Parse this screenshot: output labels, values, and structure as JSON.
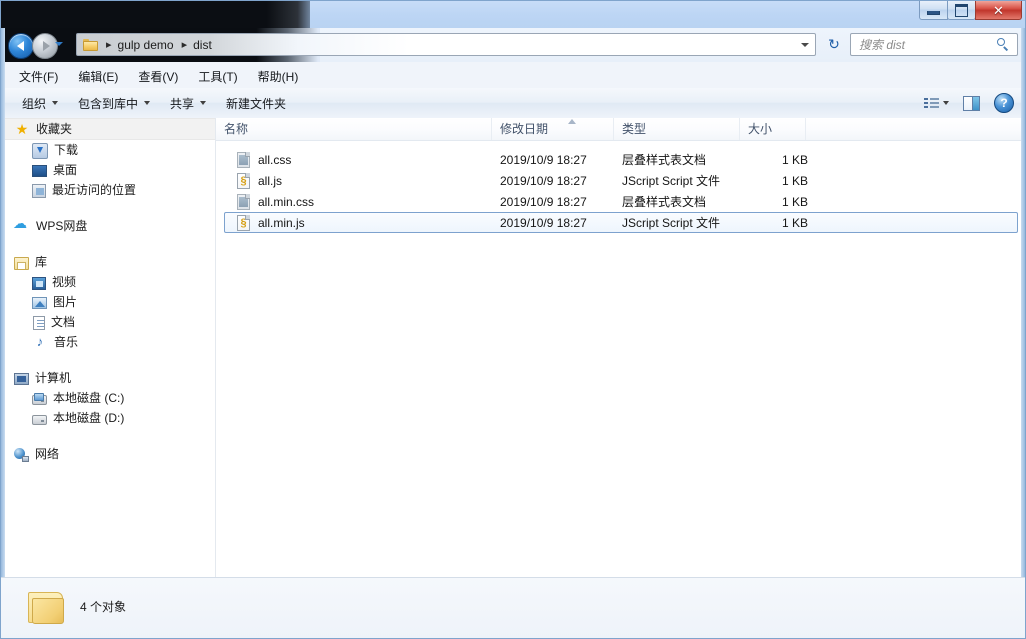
{
  "window": {
    "controls": {
      "minimize": "minimize",
      "maximize": "maximize",
      "close": "✕"
    }
  },
  "address": {
    "breadcrumb": [
      {
        "label": "gulp demo"
      },
      {
        "label": "dist"
      }
    ],
    "separator": "▸",
    "dropdown": "▾",
    "refresh_icon": "↻"
  },
  "search": {
    "placeholder": "搜索 dist",
    "value": ""
  },
  "menubar": {
    "items": [
      {
        "label": "文件(F)"
      },
      {
        "label": "编辑(E)"
      },
      {
        "label": "查看(V)"
      },
      {
        "label": "工具(T)"
      },
      {
        "label": "帮助(H)"
      }
    ]
  },
  "toolbar": {
    "items": [
      {
        "label": "组织",
        "has_caret": true
      },
      {
        "label": "包含到库中",
        "has_caret": true
      },
      {
        "label": "共享",
        "has_caret": true
      },
      {
        "label": "新建文件夹",
        "has_caret": false
      }
    ],
    "help_label": "?"
  },
  "sidebar": {
    "groups": [
      {
        "header": {
          "label": "收藏夹",
          "icon": "star-icon"
        },
        "items": [
          {
            "label": "下载",
            "icon": "download-icon"
          },
          {
            "label": "桌面",
            "icon": "desktop-icon"
          },
          {
            "label": "最近访问的位置",
            "icon": "recent-places-icon"
          }
        ]
      },
      {
        "header": {
          "label": "WPS网盘",
          "icon": "cloud-icon"
        },
        "items": []
      },
      {
        "header": {
          "label": "库",
          "icon": "library-icon"
        },
        "items": [
          {
            "label": "视频",
            "icon": "video-icon"
          },
          {
            "label": "图片",
            "icon": "picture-icon"
          },
          {
            "label": "文档",
            "icon": "document-icon"
          },
          {
            "label": "音乐",
            "icon": "music-icon"
          }
        ]
      },
      {
        "header": {
          "label": "计算机",
          "icon": "computer-icon"
        },
        "items": [
          {
            "label": "本地磁盘 (C:)",
            "icon": "system-drive-icon"
          },
          {
            "label": "本地磁盘 (D:)",
            "icon": "drive-icon"
          }
        ]
      },
      {
        "header": {
          "label": "网络",
          "icon": "network-icon"
        },
        "items": []
      }
    ]
  },
  "filelist": {
    "columns": [
      {
        "label": "名称"
      },
      {
        "label": "修改日期"
      },
      {
        "label": "类型"
      },
      {
        "label": "大小"
      }
    ],
    "sort_column": "名称",
    "rows": [
      {
        "name": "all.css",
        "date": "2019/10/9 18:27",
        "type": "层叠样式表文档",
        "size": "1 KB",
        "icon": "css-file-icon",
        "selected": false,
        "glyph": ""
      },
      {
        "name": "all.js",
        "date": "2019/10/9 18:27",
        "type": "JScript Script 文件",
        "size": "1 KB",
        "icon": "js-file-icon",
        "selected": false,
        "glyph": "§"
      },
      {
        "name": "all.min.css",
        "date": "2019/10/9 18:27",
        "type": "层叠样式表文档",
        "size": "1 KB",
        "icon": "css-file-icon",
        "selected": false,
        "glyph": ""
      },
      {
        "name": "all.min.js",
        "date": "2019/10/9 18:27",
        "type": "JScript Script 文件",
        "size": "1 KB",
        "icon": "js-file-icon",
        "selected": true,
        "glyph": "§"
      }
    ]
  },
  "statusbar": {
    "text": "4 个对象"
  },
  "colors": {
    "accent": "#2f86d8",
    "close_button": "#c0362c",
    "title_glass": "#c2d9f7",
    "selection_border": "#7da2ce",
    "folder_yellow": "#f2cf74"
  }
}
